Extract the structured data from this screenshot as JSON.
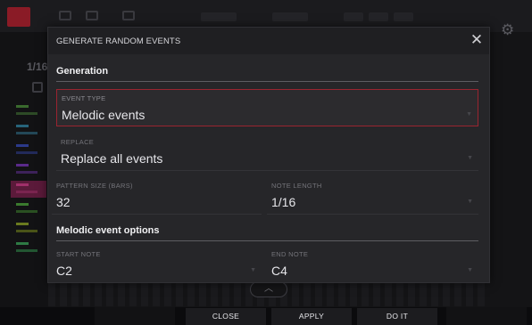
{
  "dialog": {
    "title": "GENERATE RANDOM EVENTS",
    "close_icon": "close-icon",
    "sections": {
      "generation": {
        "title": "Generation"
      },
      "melodic": {
        "title": "Melodic event options"
      }
    },
    "fields": {
      "event_type": {
        "label": "EVENT TYPE",
        "value": "Melodic events"
      },
      "replace": {
        "label": "REPLACE",
        "value": "Replace all events"
      },
      "pattern_size": {
        "label": "PATTERN SIZE (BARS)",
        "value": "32"
      },
      "note_length": {
        "label": "NOTE LENGTH",
        "value": "1/16"
      },
      "start_note": {
        "label": "START NOTE",
        "value": "C2"
      },
      "end_note": {
        "label": "END NOTE",
        "value": "C4"
      }
    }
  },
  "background": {
    "resolution": "1/16",
    "tracks": [
      "track-1",
      "track-2",
      "track-3",
      "track-4",
      "track-5",
      "track-6",
      "track-7",
      "track-8"
    ]
  },
  "footer": {
    "close_label": "CLOSE",
    "apply_label": "APPLY",
    "do_it_label": "DO IT"
  },
  "colors": {
    "accent_red": "#9a2430",
    "dialog_bg": "#262629",
    "text": "#e6e6ea"
  }
}
